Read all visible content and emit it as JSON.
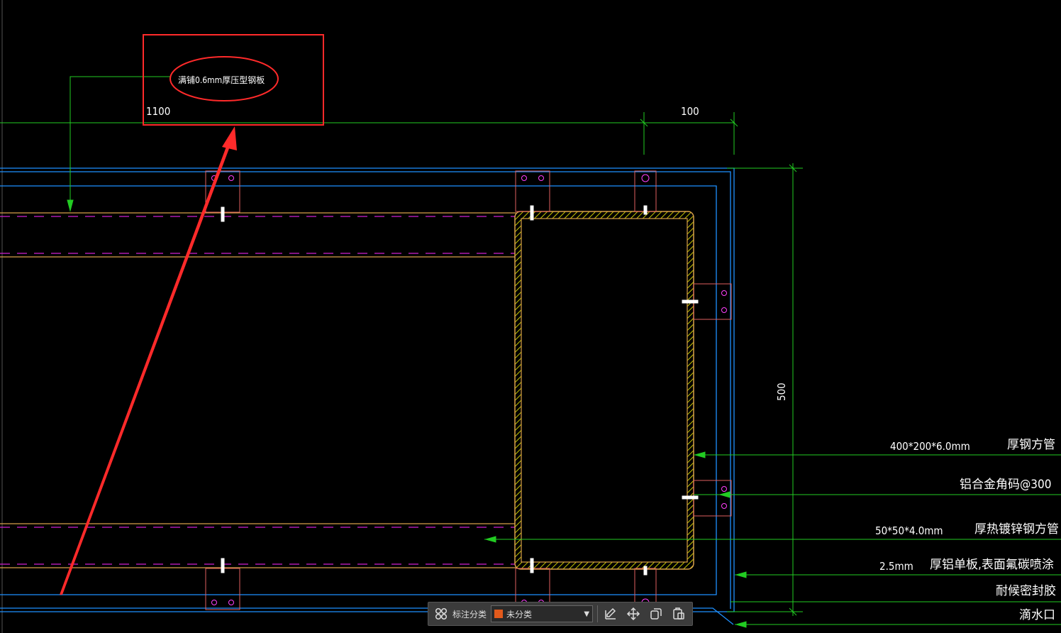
{
  "drawing": {
    "dimensions": {
      "width_1100": "1100",
      "width_100": "100",
      "height_500": "500"
    },
    "annotations": {
      "circled_label": "满铺0.6mm厚压型钢板"
    },
    "leaders": [
      {
        "spec": "400*200*6.0mm",
        "material": "厚钢方管"
      },
      {
        "spec": "",
        "material": "铝合金角码@300"
      },
      {
        "spec": "50*50*4.0mm",
        "material": "厚热镀锌钢方管"
      },
      {
        "spec": "2.5mm",
        "material": "厚铝单板,表面氟碳喷涂"
      },
      {
        "spec": "",
        "material": "耐候密封胶"
      },
      {
        "spec": "",
        "material": "滴水口"
      }
    ],
    "colors": {
      "background": "#000000",
      "dimension": "#00ff00",
      "outline": "#1e90ff",
      "hatch": "#ffff00",
      "centerline": "#ff00ff",
      "highlight": "#ff2a2a",
      "text": "#ffffff"
    }
  },
  "toolbar": {
    "category_label": "标注分类",
    "category_value": "未分类",
    "category_color": "#e25a1c",
    "icons": [
      "grid-icon",
      "edit-icon",
      "move-icon",
      "copy-icon",
      "paste-icon"
    ]
  }
}
